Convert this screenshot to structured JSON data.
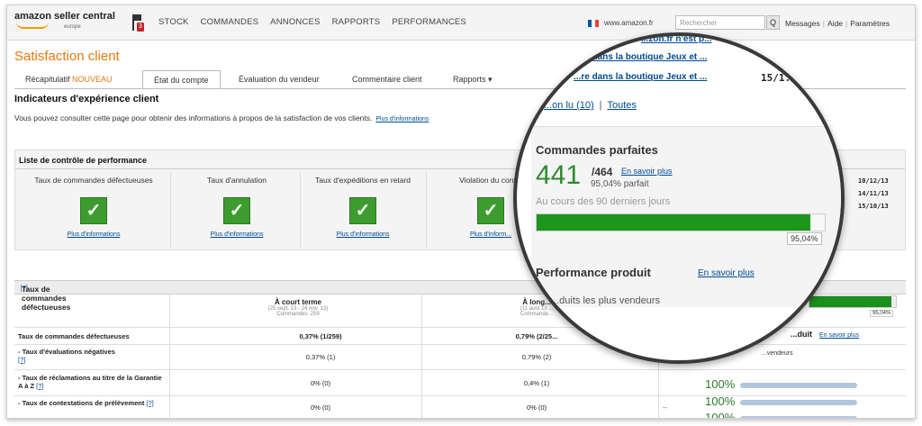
{
  "nav": {
    "logo_line1": "amazon seller central",
    "logo_line2": "europe",
    "flag_badge": "3",
    "links": [
      "STOCK",
      "COMMANDES",
      "ANNONCES",
      "RAPPORTS",
      "PERFORMANCES"
    ],
    "site": "www.amazon.fr",
    "search_placeholder": "Rechercher",
    "search_button": "Q",
    "top_links": [
      "Messages",
      "Aide",
      "Paramètres"
    ]
  },
  "page": {
    "title": "Satisfaction client",
    "tabs": [
      {
        "label": "Récapitulatif",
        "badge": "NOUVEAU"
      },
      {
        "label": "État du compte",
        "active": true
      },
      {
        "label": "Évaluation du vendeur"
      },
      {
        "label": "Commentaire client"
      },
      {
        "label": "Rapports ▾"
      }
    ],
    "section_title": "Indicateurs d'expérience client",
    "intro": "Vous pouvez consulter cette page pour obtenir des informations à propos de la satisfaction de vos clients.",
    "intro_link": "Plus d'informations"
  },
  "checklist": {
    "title": "Liste de contrôle de performance",
    "items": [
      {
        "label": "Taux de commandes défectueuses",
        "link": "Plus d'informations"
      },
      {
        "label": "Taux d'annulation",
        "link": "Plus d'informations"
      },
      {
        "label": "Taux d'expéditions en retard",
        "link": "Plus d'informations"
      },
      {
        "label": "Violation du cont...",
        "link": "Plus d'inform..."
      }
    ],
    "check_glyph": "✓"
  },
  "taux": {
    "title": "Taux de commandes défectueuses",
    "help": "[?]",
    "col1": {
      "title": "À court terme",
      "sub1": "(25 sept. 13 - 24 nov. 13)",
      "sub2": "Commandes: 259"
    },
    "col2": {
      "title": "À long...",
      "sub1": "(11 août 13 ...",
      "sub2": "Commande..."
    },
    "rows": [
      {
        "name": "Taux de commandes défectueuses",
        "v1": "0,37% (1/259)",
        "v2": "0,79% (2/25...",
        "v3": ""
      },
      {
        "name": "- Taux d'évaluations négatives",
        "help": "[?]",
        "v1": "0,37% (1)",
        "v2": "0,79% (2)",
        "v3": ""
      },
      {
        "name": "- Taux de réclamations au titre de la Garantie A à Z",
        "help": "[?]",
        "v1": "0% (0)",
        "v2": "0,4% (1)",
        "v3": ""
      },
      {
        "name": "- Taux de contestations de prélèvement",
        "help": "[?]",
        "v1": "0% (0)",
        "v2": "0% (0)",
        "v3": "--"
      }
    ]
  },
  "right": {
    "dates": [
      "10/12/13",
      "14/11/13",
      "15/10/13"
    ],
    "product_title": "...duit",
    "product_link": "En savoir plus",
    "vendeurs": "...vendeurs",
    "bar_label": "95,04%",
    "bar_fraction": 0.9504,
    "percents": [
      "100%",
      "100%",
      "100%"
    ]
  },
  "lens": {
    "top_link1": "...zon.fr n'est p...",
    "top_link2": "...re dans la boutique Jeux et ...",
    "top_link2_date": "15/1...",
    "top_link3": "...re dans la boutique Jeux et ...",
    "top_link3_date": "",
    "non_lu": "...on lu (10)",
    "toutes": "Toutes",
    "cp_title": "Commandes parfaites",
    "cp_value": "441",
    "cp_total": "/464",
    "cp_link": "En savoir plus",
    "cp_pct": "95,04% parfait",
    "cp_period": "Au cours des 90 derniers jours",
    "cp_bar_label": "95,04%",
    "cp_bar_fraction": 0.9504,
    "pp_title": "Performance produit",
    "pp_link": "En savoir plus",
    "pp_sub": "...duits les plus vendeurs"
  },
  "colors": {
    "accent": "#e47911",
    "link": "#004b91",
    "green": "#3c9c2e"
  }
}
